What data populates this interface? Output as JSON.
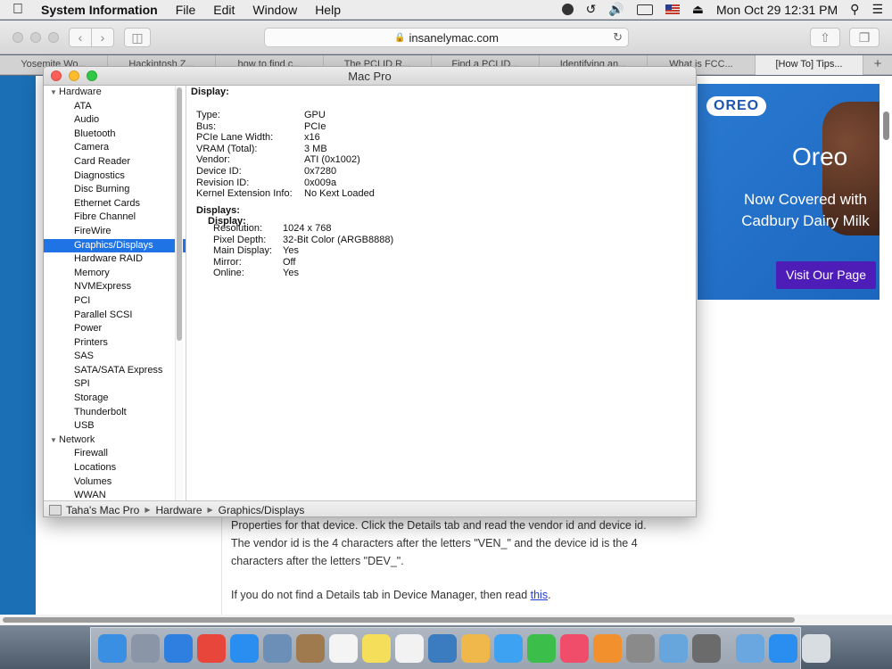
{
  "menubar": {
    "app_name": "System Information",
    "menus": [
      "File",
      "Edit",
      "Window",
      "Help"
    ],
    "datetime": "Mon Oct 29  12:31 PM"
  },
  "browser": {
    "url": "insanelymac.com",
    "tabs": [
      {
        "label": "Yosemite Wo...",
        "active": false
      },
      {
        "label": "Hackintosh Z...",
        "active": false
      },
      {
        "label": "how to find c...",
        "active": false
      },
      {
        "label": "The PCI ID R...",
        "active": false
      },
      {
        "label": "Find a PCI ID...",
        "active": false
      },
      {
        "label": "Identifying an...",
        "active": false
      },
      {
        "label": "What is FCC...",
        "active": false
      },
      {
        "label": "[How To] Tips...",
        "active": true
      }
    ],
    "new_tab_label": "+"
  },
  "page": {
    "paragraph1": "Properties for that device. Click the Details tab and read the vendor id and device id. The vendor id is the 4 characters after the letters \"VEN_\" and the device id is the 4 characters after the letters \"DEV_\".",
    "paragraph2_prefix": "If you do not find a Details tab in Device Manager, then read ",
    "paragraph2_link": "this",
    "paragraph2_suffix": "."
  },
  "ad": {
    "brand": "OREO",
    "title": "Oreo",
    "subtitle": "Now Covered with Cadbury Dairy Milk",
    "button": "Visit Our Page"
  },
  "window": {
    "title": "Mac Pro",
    "sidebar": {
      "groups": [
        {
          "label": "Hardware",
          "items": [
            "ATA",
            "Audio",
            "Bluetooth",
            "Camera",
            "Card Reader",
            "Diagnostics",
            "Disc Burning",
            "Ethernet Cards",
            "Fibre Channel",
            "FireWire",
            "Graphics/Displays",
            "Hardware RAID",
            "Memory",
            "NVMExpress",
            "PCI",
            "Parallel SCSI",
            "Power",
            "Printers",
            "SAS",
            "SATA/SATA Express",
            "SPI",
            "Storage",
            "Thunderbolt",
            "USB"
          ]
        },
        {
          "label": "Network",
          "items": [
            "Firewall",
            "Locations",
            "Volumes",
            "WWAN"
          ]
        }
      ],
      "selected": "Graphics/Displays"
    },
    "detail": {
      "heading": "Display:",
      "properties": [
        {
          "key": "Type:",
          "value": "GPU"
        },
        {
          "key": "Bus:",
          "value": "PCIe"
        },
        {
          "key": "PCIe Lane Width:",
          "value": "x16"
        },
        {
          "key": "VRAM (Total):",
          "value": "3 MB"
        },
        {
          "key": "Vendor:",
          "value": "ATI (0x1002)"
        },
        {
          "key": "Device ID:",
          "value": "0x7280"
        },
        {
          "key": "Revision ID:",
          "value": "0x009a"
        },
        {
          "key": "Kernel Extension Info:",
          "value": "No Kext Loaded"
        }
      ],
      "displays_label": "Displays:",
      "display_sub_label": "Display:",
      "display_properties": [
        {
          "key": "Resolution:",
          "value": "1024 x 768"
        },
        {
          "key": "Pixel Depth:",
          "value": "32-Bit Color (ARGB8888)"
        },
        {
          "key": "Main Display:",
          "value": "Yes"
        },
        {
          "key": "Mirror:",
          "value": "Off"
        },
        {
          "key": "Online:",
          "value": "Yes"
        }
      ]
    },
    "path": [
      "Taha's Mac Pro",
      "Hardware",
      "Graphics/Displays"
    ]
  },
  "dock": {
    "icons": [
      {
        "name": "finder-icon",
        "color": "#3b8fe3"
      },
      {
        "name": "launchpad-icon",
        "color": "#8a96a8"
      },
      {
        "name": "safari-icon",
        "color": "#2f7fe0"
      },
      {
        "name": "chrome-icon",
        "color": "#e8463a"
      },
      {
        "name": "app-store-icon",
        "color": "#2a8ef0"
      },
      {
        "name": "preview-icon",
        "color": "#6c8fb8"
      },
      {
        "name": "contacts-icon",
        "color": "#a07a4f"
      },
      {
        "name": "calendar-icon",
        "color": "#f4f4f4"
      },
      {
        "name": "notes-icon",
        "color": "#f5de5a"
      },
      {
        "name": "reminders-icon",
        "color": "#f2f2f2"
      },
      {
        "name": "photo-booth-icon",
        "color": "#3b7bbf"
      },
      {
        "name": "photos-icon",
        "color": "#f0b74a"
      },
      {
        "name": "messages-icon",
        "color": "#3ea2f2"
      },
      {
        "name": "facetime-icon",
        "color": "#3cbf4a"
      },
      {
        "name": "itunes-icon",
        "color": "#f04d6b"
      },
      {
        "name": "ibooks-icon",
        "color": "#f2902e"
      },
      {
        "name": "system-preferences-icon",
        "color": "#8a8a8a"
      },
      {
        "name": "app-store-2-icon",
        "color": "#67a6dc"
      },
      {
        "name": "terminal-icon",
        "color": "#6b6b6b"
      },
      {
        "name": "downloads-icon",
        "color": "#6aa6e0"
      },
      {
        "name": "apps-folder-icon",
        "color": "#2a8ef0"
      },
      {
        "name": "trash-icon",
        "color": "#d8dde2"
      }
    ]
  }
}
